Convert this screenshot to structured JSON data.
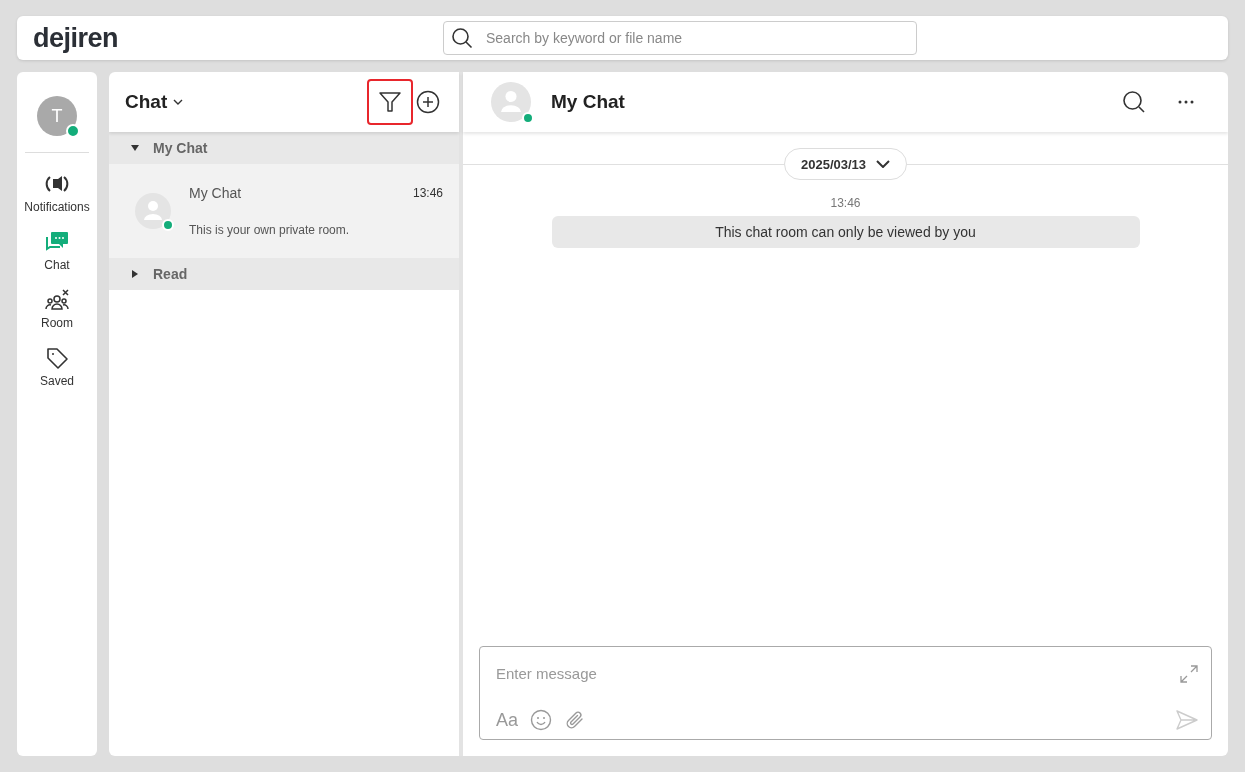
{
  "header": {
    "logo": "dejiren",
    "search": {
      "placeholder": "Search by keyword or file name"
    }
  },
  "nav": {
    "avatar": "T",
    "online": true,
    "items": [
      {
        "label": "Notifications",
        "kind": "notifications",
        "selected": false
      },
      {
        "label": "Chat",
        "kind": "chat",
        "selected": true
      },
      {
        "label": "Room",
        "kind": "room",
        "selected": false
      },
      {
        "label": "Saved",
        "kind": "saved",
        "selected": false
      }
    ]
  },
  "chat_list": {
    "title": "Chat",
    "filter_highlighted": true,
    "groups": [
      {
        "label": "My Chat",
        "expanded": true,
        "rooms": [
          {
            "name": "My Chat",
            "time": "13:46",
            "preview": "This is your own private room.",
            "online": true,
            "selected": true
          }
        ]
      },
      {
        "label": "Read",
        "expanded": false
      }
    ]
  },
  "room": {
    "title": "My Chat",
    "online": true,
    "date": "2025/03/13",
    "messages": [
      {
        "time": "13:46",
        "text": "This chat room can only be viewed by you"
      }
    ],
    "composer": {
      "placeholder": "Enter message",
      "format_label": "Aa"
    }
  }
}
